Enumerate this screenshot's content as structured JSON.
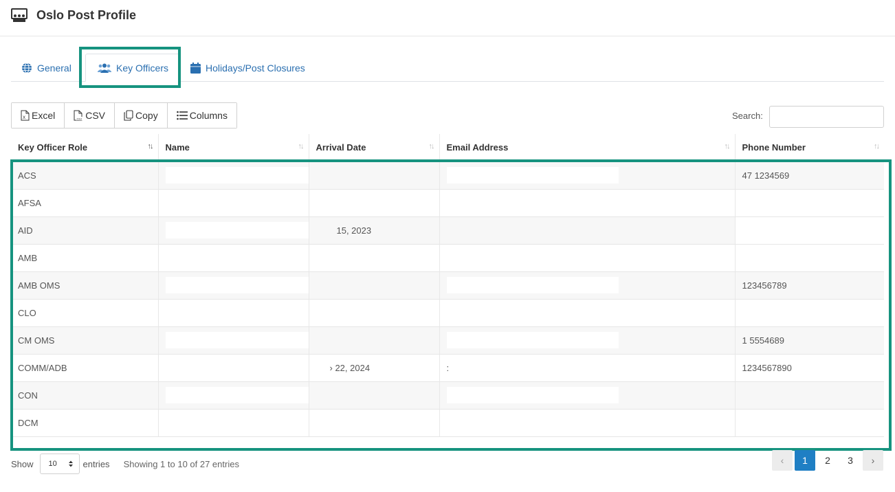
{
  "header": {
    "title": "Oslo Post Profile",
    "icon": "meeting-room-icon"
  },
  "tabs": [
    {
      "label": "General",
      "icon": "globe-icon"
    },
    {
      "label": "Key Officers",
      "icon": "users-icon",
      "active": true
    },
    {
      "label": "Holidays/Post Closures",
      "icon": "calendar-icon"
    }
  ],
  "toolbar": {
    "excel": "Excel",
    "csv": "CSV",
    "copy": "Copy",
    "columns": "Columns"
  },
  "search": {
    "label": "Search:",
    "value": ""
  },
  "table": {
    "columns": [
      "Key Officer Role",
      "Name",
      "Arrival Date",
      "Email Address",
      "Phone Number"
    ],
    "rows": [
      {
        "role": "ACS",
        "name": "",
        "arrival": "",
        "email": "",
        "phone": "47 1234569"
      },
      {
        "role": "AFSA",
        "name": "",
        "arrival": "",
        "email": "",
        "phone": ""
      },
      {
        "role": "AID",
        "name": "",
        "arrival": "15, 2023",
        "email": "",
        "phone": ""
      },
      {
        "role": "AMB",
        "name": "",
        "arrival": "",
        "email": "",
        "phone": ""
      },
      {
        "role": "AMB OMS",
        "name": "",
        "arrival": "",
        "email": "",
        "phone": "123456789"
      },
      {
        "role": "CLO",
        "name": "",
        "arrival": "",
        "email": "",
        "phone": ""
      },
      {
        "role": "CM OMS",
        "name": "",
        "arrival": "",
        "email": "",
        "phone": "1 5554689"
      },
      {
        "role": "COMM/ADB",
        "name": "",
        "arrival": "› 22, 2024",
        "email": ":",
        "phone": "1234567890"
      },
      {
        "role": "CON",
        "name": "",
        "arrival": "",
        "email": "",
        "phone": ""
      },
      {
        "role": "DCM",
        "name": "",
        "arrival": "",
        "email": "",
        "phone": ""
      }
    ]
  },
  "footer": {
    "show_label": "Show",
    "page_length": "10",
    "entries_label": "entries",
    "info": "Showing 1 to 10 of 27 entries"
  },
  "pagination": {
    "pages": [
      "1",
      "2",
      "3"
    ],
    "current": "1",
    "prev": "‹",
    "next": "›"
  },
  "colors": {
    "accent": "#16937f",
    "link": "#2a6fb0",
    "primary": "#1f7fc4"
  }
}
